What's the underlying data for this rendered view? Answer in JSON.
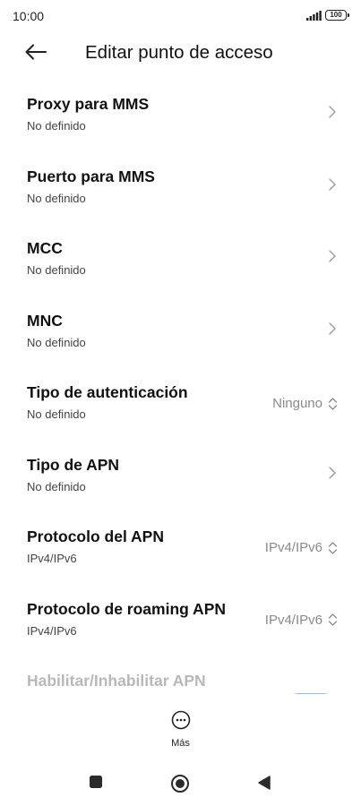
{
  "status_bar": {
    "time": "10:00",
    "battery": "100"
  },
  "header": {
    "title": "Editar punto de acceso"
  },
  "settings": [
    {
      "title": "Proxy para MMS",
      "subtitle": "No definido",
      "value": "",
      "control": "chevron"
    },
    {
      "title": "Puerto para MMS",
      "subtitle": "No definido",
      "value": "",
      "control": "chevron"
    },
    {
      "title": "MCC",
      "subtitle": "No definido",
      "value": "",
      "control": "chevron"
    },
    {
      "title": "MNC",
      "subtitle": "No definido",
      "value": "",
      "control": "chevron"
    },
    {
      "title": "Tipo de autenticación",
      "subtitle": "No definido",
      "value": "Ninguno",
      "control": "dropdown"
    },
    {
      "title": "Tipo de APN",
      "subtitle": "No definido",
      "value": "",
      "control": "chevron"
    },
    {
      "title": "Protocolo del APN",
      "subtitle": "IPv4/IPv6",
      "value": "IPv4/IPv6",
      "control": "dropdown"
    },
    {
      "title": "Protocolo de roaming APN",
      "subtitle": "IPv4/IPv6",
      "value": "IPv4/IPv6",
      "control": "dropdown"
    },
    {
      "title": "Habilitar/Inhabilitar APN",
      "subtitle": "",
      "value": "",
      "control": "toggle",
      "toggle_on": true
    }
  ],
  "more": {
    "label": "Más"
  },
  "colors": {
    "accent": "#8fbcf8",
    "value_text": "#8a8a8a",
    "disabled_text": "#b8b8b8"
  },
  "icons": {
    "back": "arrow-left-icon",
    "chevron": "chevron-right-icon",
    "dropdown": "up-down-arrows-icon",
    "more": "more-horizontal-icon",
    "nav_recents": "square-icon",
    "nav_home": "circle-icon",
    "nav_back": "triangle-left-icon"
  }
}
